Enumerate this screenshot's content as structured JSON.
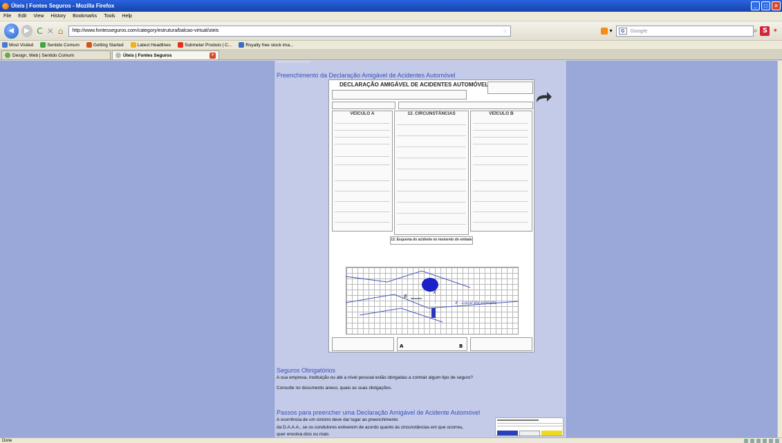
{
  "window": {
    "title": "Úteis | Fontes Seguros - Mozilla Firefox"
  },
  "menu": [
    "File",
    "Edit",
    "View",
    "History",
    "Bookmarks",
    "Tools",
    "Help"
  ],
  "nav": {
    "url": "http://www.fontesseguros.com/category/estrutura/balcao-virtual/uteis",
    "search_placeholder": "Google"
  },
  "bookmarks": [
    {
      "label": "Most Visited",
      "color": "#4a7ad1"
    },
    {
      "label": "Sentido Comum",
      "color": "#3fa54a"
    },
    {
      "label": "Getting Started",
      "color": "#d1561b"
    },
    {
      "label": "Latest Headlines",
      "color": "#f2b01e"
    },
    {
      "label": "Submeter Produto | C...",
      "color": "#e2301f"
    },
    {
      "label": "Royalty free stock ima...",
      "color": "#3c6bc2"
    }
  ],
  "tabs": [
    {
      "label": "Design, Web | Sentido Comum",
      "active": false
    },
    {
      "label": "Úteis | Fontes Seguros",
      "active": true
    }
  ],
  "page": {
    "heading1": "Preenchimento da Declaração Amigável de Acidentes Automóvel",
    "heading2": "Seguros Obrigatórios",
    "para2a": "A sua empresa, instituição ou até a nível pessoal estão obrigadas a contrair algum tipo de seguro?",
    "para2b": "Consulte no documento anexo, quais as suas obrigações.",
    "heading3": "Passos para preencher uma Declaração Amigável de Acidente Automóvel",
    "para3a": "A ocorrência de um sinistro deve dar lugar ao preenchimento",
    "para3b": "da D.A.A.A., se os condutores estiverem de acordo quanto às circunstâncias em que ocorreu,",
    "para3c": "quer envolva dois ou mais"
  },
  "form": {
    "title": "DECLARAÇÃO AMIGÁVEL DE ACIDENTES AUTOMÓVEL",
    "vehicle_a": "VEÍCULO A",
    "circumstances": "12. CIRCUNSTÂNCIAS",
    "vehicle_b": "VEÍCULO B",
    "sketch": "13. Esquema do acidente no momento do embate",
    "local": "X - Local do embate",
    "marker_a": "A",
    "marker_b": "B",
    "marker_x": "X"
  },
  "status": {
    "text": "Done"
  }
}
